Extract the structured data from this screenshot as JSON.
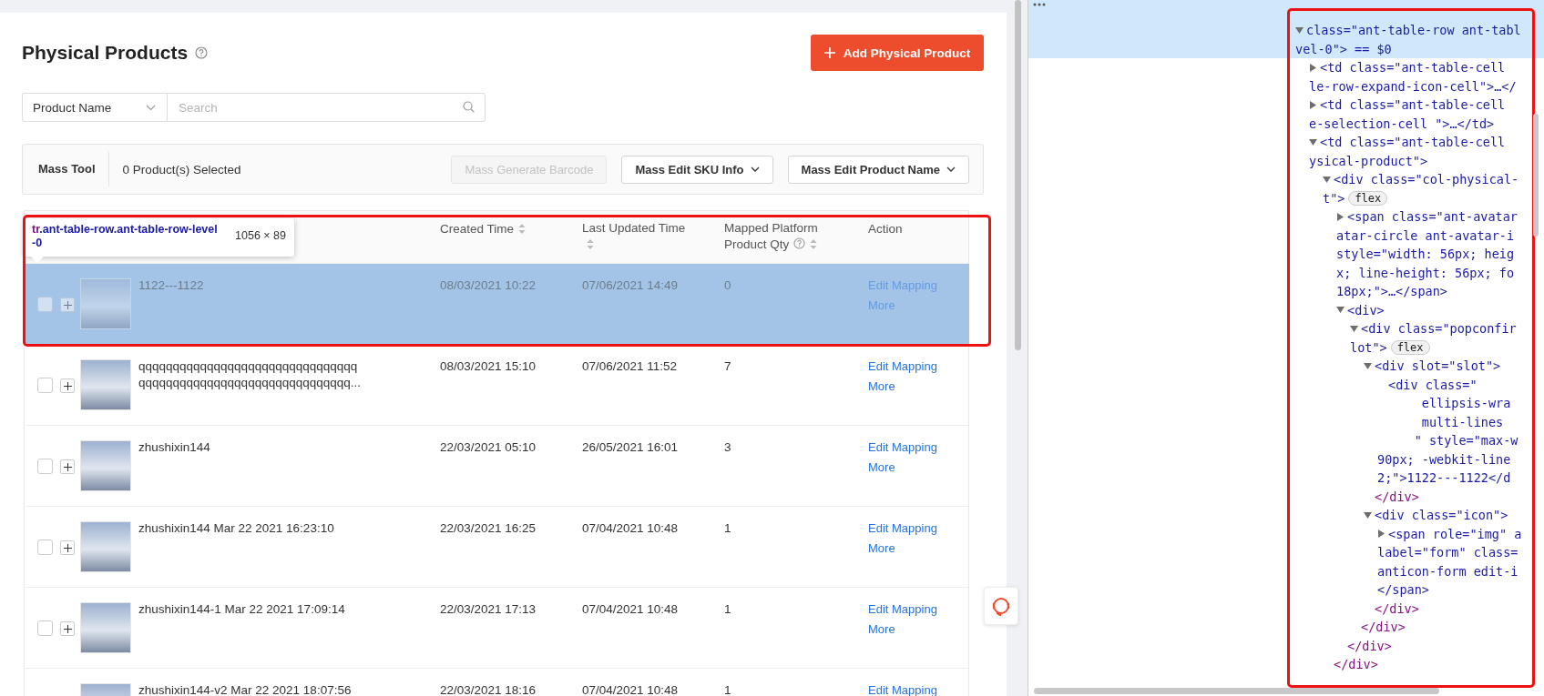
{
  "page": {
    "title": "Physical Products",
    "add_button": "Add Physical Product",
    "search": {
      "filter": "Product Name",
      "placeholder": "Search"
    },
    "mass_tool": {
      "label": "Mass Tool",
      "selected_count": "0 Product(s) Selected",
      "buttons": [
        {
          "label": "Mass Generate Barcode",
          "disabled": true,
          "dropdown": false
        },
        {
          "label": "Mass Edit SKU Info",
          "disabled": false,
          "dropdown": true
        },
        {
          "label": "Mass Edit Product Name",
          "disabled": false,
          "dropdown": true
        }
      ]
    },
    "table": {
      "columns": [
        {
          "label": "Created Time",
          "sortable": true,
          "help": false
        },
        {
          "label": "Last Updated Time",
          "sortable": true,
          "help": false
        },
        {
          "label": "Mapped Platform Product Qty",
          "sortable": true,
          "help": true
        },
        {
          "label": "Action",
          "sortable": false,
          "help": false
        }
      ],
      "rows": [
        {
          "name": "1122---1122",
          "created": "08/03/2021 10:22",
          "updated": "07/06/2021 14:49",
          "qty": "0",
          "actions": [
            "Edit Mapping",
            "More"
          ],
          "highlighted": true
        },
        {
          "name": "qqqqqqqqqqqqqqqqqqqqqqqqqqqqqqqqqqqqqqqqqqqqqqqqqqqqqqqqqqqqqqq...",
          "created": "08/03/2021 15:10",
          "updated": "07/06/2021 11:52",
          "qty": "7",
          "actions": [
            "Edit Mapping",
            "More"
          ],
          "highlighted": false
        },
        {
          "name": "zhushixin144",
          "created": "22/03/2021 05:10",
          "updated": "26/05/2021 16:01",
          "qty": "3",
          "actions": [
            "Edit Mapping",
            "More"
          ],
          "highlighted": false
        },
        {
          "name": "zhushixin144 Mar 22 2021 16:23:10",
          "created": "22/03/2021 16:25",
          "updated": "07/04/2021 10:48",
          "qty": "1",
          "actions": [
            "Edit Mapping",
            "More"
          ],
          "highlighted": false
        },
        {
          "name": "zhushixin144-1 Mar 22 2021 17:09:14",
          "created": "22/03/2021 17:13",
          "updated": "07/04/2021 10:48",
          "qty": "1",
          "actions": [
            "Edit Mapping",
            "More"
          ],
          "highlighted": false
        },
        {
          "name": "zhushixin144-v2 Mar 22 2021 18:07:56",
          "created": "22/03/2021 18:16",
          "updated": "07/04/2021 10:48",
          "qty": "1",
          "actions": [
            "Edit Mapping"
          ],
          "highlighted": false
        }
      ]
    }
  },
  "inspector_tooltip": {
    "tag": "tr",
    "classes": ".ant-table-row.ant-table-row-level-0",
    "size": "1056 × 89"
  },
  "devtools": {
    "tree": [
      {
        "kind": "element",
        "expanded": true,
        "selected": true,
        "lines": [
          "class=\"ant-table-row ant-tabl",
          "vel-0\"> == $0"
        ],
        "children": [
          {
            "kind": "element",
            "expanded": false,
            "selected": false,
            "lines": [
              "<td class=\"ant-table-cell",
              "le-row-expand-icon-cell\">…</"
            ]
          },
          {
            "kind": "element",
            "expanded": false,
            "selected": false,
            "lines": [
              "<td class=\"ant-table-cell",
              "e-selection-cell \">…</td>"
            ]
          },
          {
            "kind": "element",
            "expanded": true,
            "selected": false,
            "lines": [
              "<td class=\"ant-table-cell",
              "ysical-product\">"
            ],
            "children": [
              {
                "kind": "element",
                "expanded": true,
                "selected": false,
                "badge": "flex",
                "lines": [
                  "<div class=\"col-physical-",
                  "t\">"
                ],
                "children": [
                  {
                    "kind": "element",
                    "expanded": false,
                    "selected": false,
                    "lines": [
                      "<span class=\"ant-avatar",
                      "atar-circle ant-avatar-i",
                      "style=\"width: 56px; heig",
                      "x; line-height: 56px; fo",
                      "18px;\">…</span>"
                    ]
                  },
                  {
                    "kind": "element",
                    "expanded": true,
                    "selected": false,
                    "lines": [
                      "<div>"
                    ],
                    "children": [
                      {
                        "kind": "element",
                        "expanded": true,
                        "selected": false,
                        "badge": "flex",
                        "lines": [
                          "<div class=\"popconfir",
                          "lot\">"
                        ],
                        "children": [
                          {
                            "kind": "element",
                            "expanded": true,
                            "selected": false,
                            "lines": [
                              "<div slot=\"slot\">"
                            ],
                            "children": [
                              {
                                "kind": "leaf",
                                "selected": false,
                                "lines": [
                                  "<div class=\"",
                                  "      ellipsis-wra",
                                  "      multi-lines",
                                  "     \" style=\"max-w",
                                  "90px; -webkit-line",
                                  "2;\">1122---1122</d"
                                ]
                              }
                            ]
                          },
                          {
                            "kind": "close",
                            "selected": false,
                            "lines": [
                              "</div>"
                            ]
                          },
                          {
                            "kind": "element",
                            "expanded": true,
                            "selected": false,
                            "lines": [
                              "<div class=\"icon\">"
                            ],
                            "children": [
                              {
                                "kind": "element",
                                "expanded": false,
                                "selected": false,
                                "lines": [
                                  "<span role=\"img\" a",
                                  "label=\"form\" class=",
                                  "anticon-form edit-i",
                                  "</span>"
                                ]
                              }
                            ]
                          },
                          {
                            "kind": "close",
                            "selected": false,
                            "lines": [
                              "</div>"
                            ]
                          }
                        ]
                      },
                      {
                        "kind": "close",
                        "selected": false,
                        "lines": [
                          "</div>"
                        ]
                      }
                    ]
                  },
                  {
                    "kind": "close",
                    "selected": false,
                    "lines": [
                      "</div>"
                    ]
                  }
                ]
              },
              {
                "kind": "close",
                "selected": false,
                "lines": [
                  "</div>"
                ]
              }
            ]
          }
        ]
      }
    ]
  }
}
